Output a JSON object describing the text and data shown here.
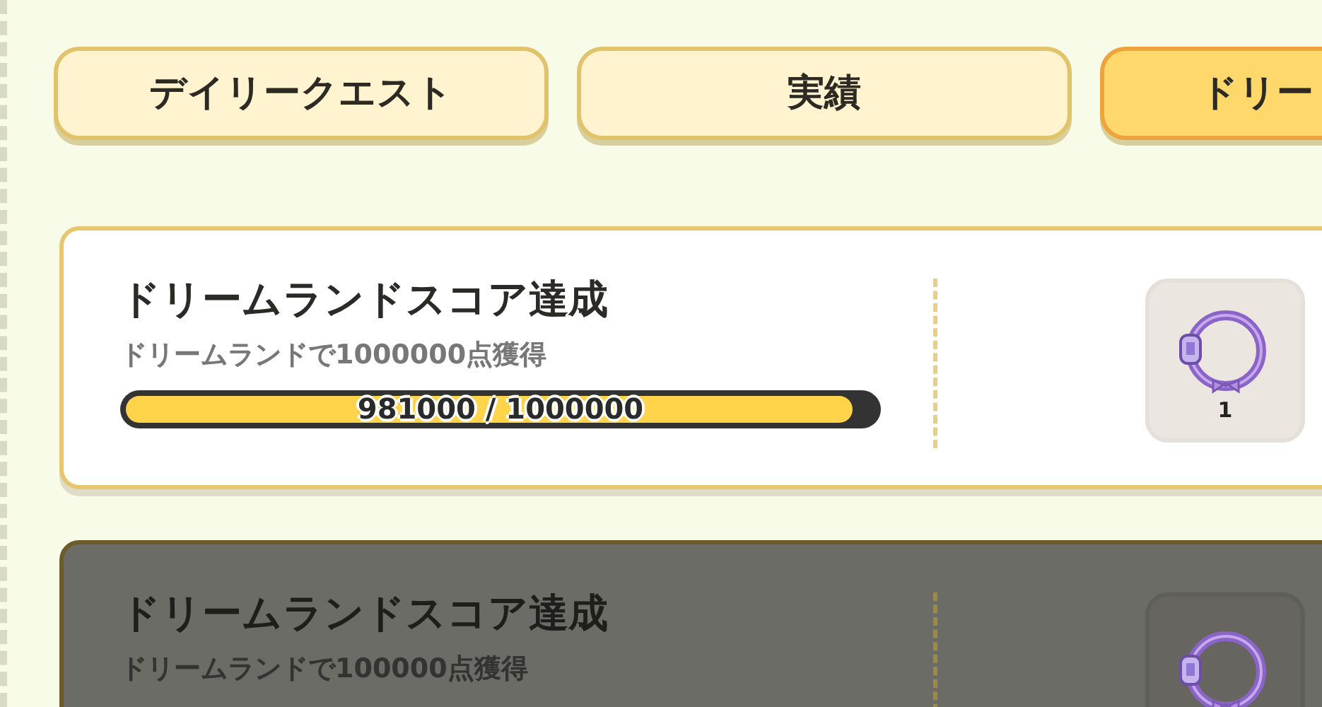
{
  "tabs": [
    {
      "label": "デイリークエスト",
      "selected": false
    },
    {
      "label": "実績",
      "selected": false
    },
    {
      "label": "ドリー",
      "selected": true
    }
  ],
  "quests": [
    {
      "title": "ドリームランドスコア達成",
      "description": "ドリームランドで1000000点獲得",
      "progress": {
        "level": 0.981,
        "reading": "981000 / 1000000"
      },
      "reward": {
        "count": "1"
      },
      "dimmed": false
    },
    {
      "title": "ドリームランドスコア達成",
      "description": "ドリームランドで100000点獲得",
      "dimmed": true
    }
  ]
}
